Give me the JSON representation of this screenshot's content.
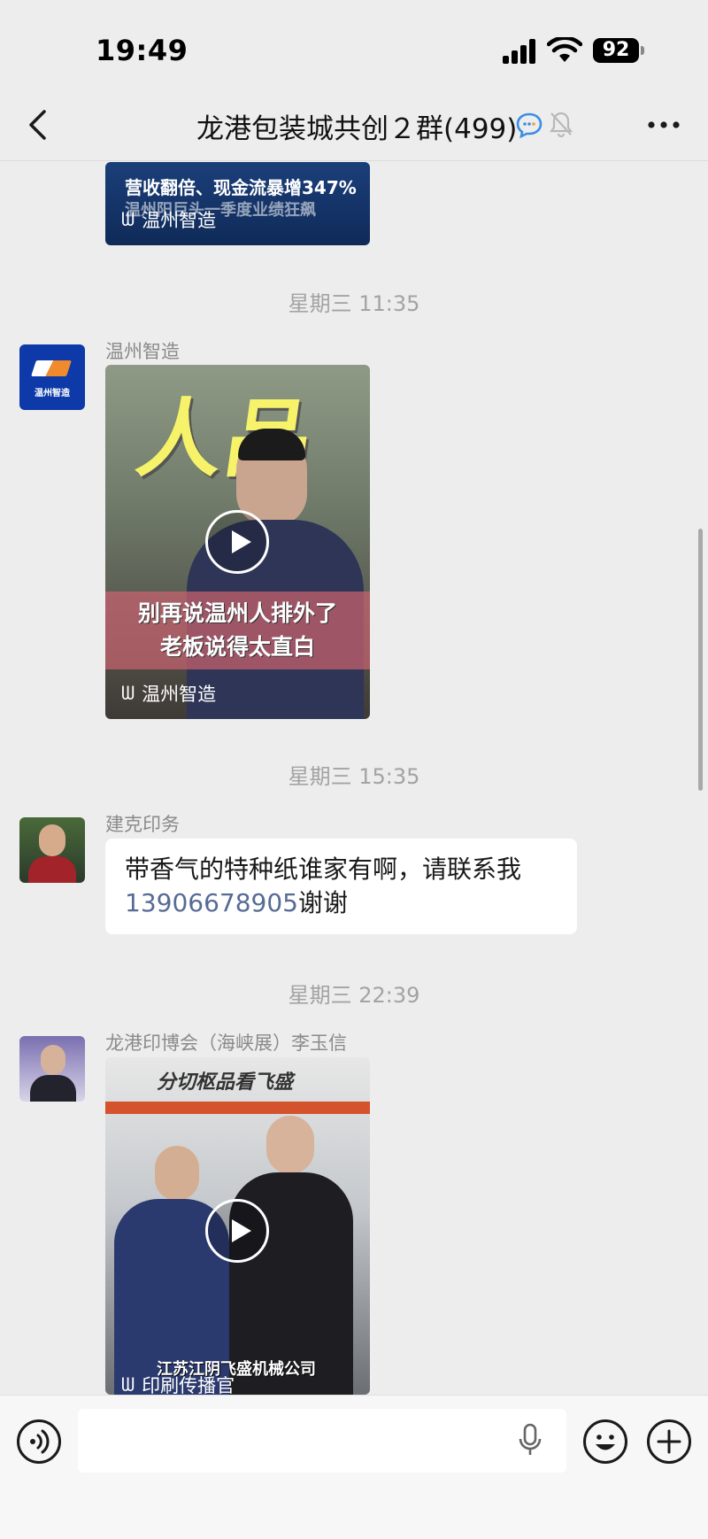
{
  "status_bar": {
    "time": "19:49",
    "battery": "92"
  },
  "nav": {
    "title": "龙港包装城共创２群(499)"
  },
  "messages": {
    "top_card": {
      "headline": "营收翻倍、现金流暴增347%",
      "subline": "温州阳巨头一季度业绩狂飙",
      "source": "温州智造"
    },
    "time1": "星期三 11:35",
    "msg1": {
      "sender": "温州智造",
      "avatar_text": "温州智造",
      "video": {
        "big_text": "人品",
        "caption_line1": "别再说温州人排外了",
        "caption_line2": "老板说得太直白",
        "source": "温州智造"
      }
    },
    "time2": "星期三 15:35",
    "msg2": {
      "sender": "建克印务",
      "text_before": "带香气的特种纸谁家有啊，请联系我",
      "phone": "13906678905",
      "text_after": "谢谢"
    },
    "time3": "星期三 22:39",
    "msg3": {
      "sender": "龙港印博会（海峡展）李玉信",
      "video": {
        "top_text": "分切枢品看飞盛",
        "bottom_text": "江苏江阴飞盛机械公司",
        "source": "印刷传播官"
      }
    }
  },
  "colors": {
    "background": "#ededed",
    "bubble": "#ffffff",
    "link": "#576b95",
    "timestamp": "#a3a3a3"
  },
  "icons": {
    "back": "chevron-left-icon",
    "chat": "chat-bubble-icon",
    "mute": "bell-off-icon",
    "more": "more-dots-icon",
    "voice": "voice-icon",
    "mic": "microphone-icon",
    "emoji": "emoji-icon",
    "plus": "plus-icon",
    "play": "play-icon"
  }
}
